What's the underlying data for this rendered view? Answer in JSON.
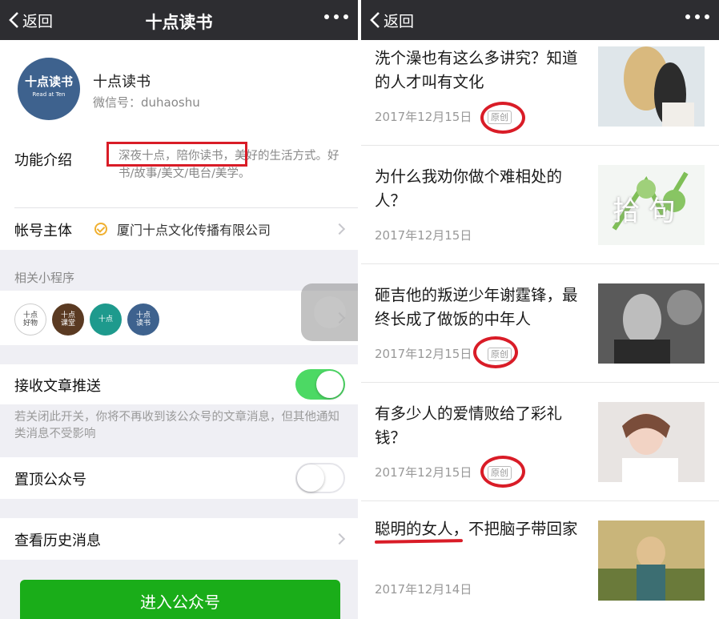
{
  "left": {
    "nav": {
      "back_label": "返回",
      "title": "十点读书"
    },
    "profile": {
      "logo_text": "十点读书",
      "logo_sub": "Read at Ten",
      "name": "十点读书",
      "wechat_id": "微信号：duhaoshu"
    },
    "intro": {
      "label": "功能介绍",
      "text": "深夜十点，陪你读书，美好的生活方式。好书/故事/美文/电台/美学。"
    },
    "owner": {
      "label": "帐号主体",
      "value": "厦门十点文化传播有限公司"
    },
    "mini_programs": {
      "header": "相关小程序",
      "items": [
        {
          "text": "十点好物",
          "color": "#ffffff"
        },
        {
          "text": "十点课堂",
          "color": "#5a3a22"
        },
        {
          "text": "十点",
          "color": "#1e9a8d"
        },
        {
          "text": "十点读书",
          "color": "#3e628e"
        }
      ]
    },
    "receive_push": {
      "label": "接收文章推送",
      "on": true
    },
    "tip": "若关闭此开关，你将不再收到该公众号的文章消息，但其他通知类消息不受影响",
    "pin_top": {
      "label": "置顶公众号",
      "on": false
    },
    "history": {
      "label": "查看历史消息"
    },
    "enter_button": "进入公众号"
  },
  "right": {
    "nav": {
      "back_label": "返回"
    },
    "articles": [
      {
        "title": "洗个澡也有这么多讲究？知道的人才叫有文化",
        "date": "2017年12月15日",
        "badge": "原创"
      },
      {
        "title": "为什么我劝你做个难相处的人？",
        "date": "2017年12月15日",
        "badge": ""
      },
      {
        "title": "砸吉他的叛逆少年谢霆锋，最终长成了做饭的中年人",
        "date": "2017年12月15日",
        "badge": "原创"
      },
      {
        "title": "有多少人的爱情败给了彩礼钱？",
        "date": "2017年12月15日",
        "badge": "原创"
      },
      {
        "title": "聪明的女人，不把脑子带回家",
        "date": "2017年12月14日",
        "badge": ""
      }
    ],
    "thumb_overlay_text": "拾 句"
  },
  "colors": {
    "nav_bg": "#2d2d31",
    "accent_green": "#1aad19",
    "toggle_on": "#4cd964",
    "annotation_red": "#d91c27"
  }
}
